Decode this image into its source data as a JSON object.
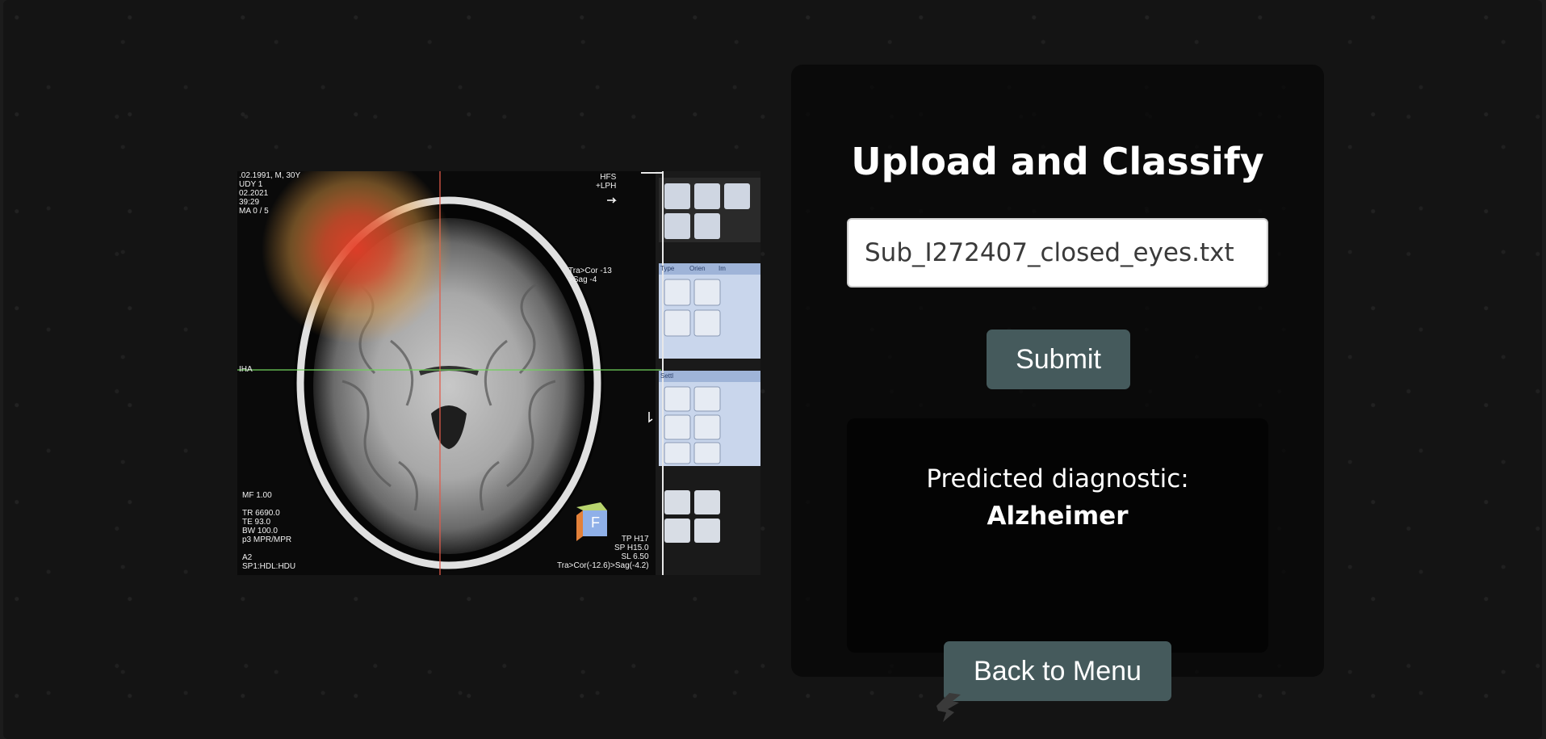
{
  "panel": {
    "title": "Upload and Classify",
    "file_input": {
      "value": "Sub_I272407_closed_eyes.txt"
    },
    "submit_label": "Submit",
    "result": {
      "label": "Predicted diagnostic:",
      "value": "Alzheimer"
    },
    "back_label": "Back to Menu"
  },
  "mri_overlay": {
    "top_left": ".02.1991, M, 30Y\nUDY 1\n02.2021\n39:29\nMA 0 / 5",
    "top_right": "HFS\n+LPH",
    "axis_right": "Tra>Cor -13\n>Sag -4",
    "left_marker": "IHA",
    "bottom_left": "MF 1.00\n\nTR 6690.0\nTE 93.0\nBW 100.0\np3 MPR/MPR\n\nA2\nSP1:HDL:HDU",
    "bottom_right": "TP H17\nSP H15.0\nSL 6.50\nTra>Cor(-12.6)>Sag(-4.2)",
    "cube_letter": "F",
    "panel_tabs": [
      "Type",
      "Orien",
      "Im"
    ],
    "panel_section": "Settl"
  },
  "colors": {
    "background": "#141414",
    "panel": "#080808",
    "button": "#455a5c",
    "heatmap": "#e8402a"
  },
  "icons": {
    "bottom_logo": "brand-logo-icon"
  }
}
